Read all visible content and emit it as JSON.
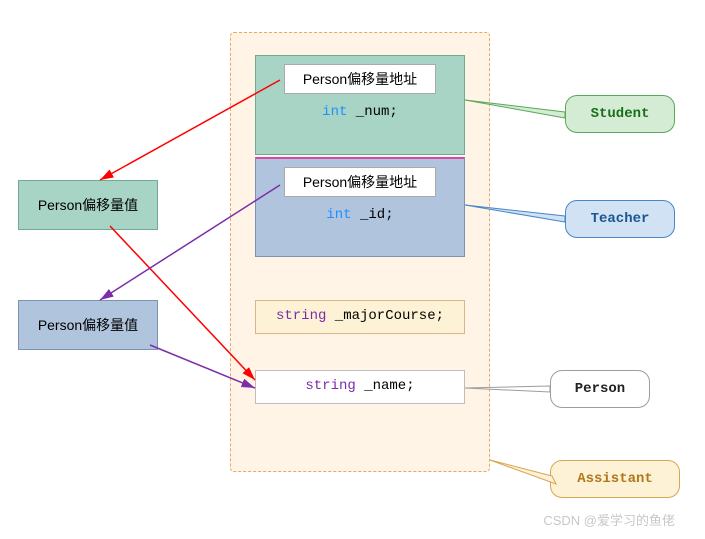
{
  "left": {
    "offset_value_1": "Person偏移量值",
    "offset_value_2": "Person偏移量值"
  },
  "container": {
    "student": {
      "addr_label": "Person偏移量地址",
      "member_type": "int",
      "member_name": "_num;"
    },
    "teacher": {
      "addr_label": "Person偏移量地址",
      "member_type": "int",
      "member_name": "_id;"
    },
    "major": {
      "type": "string",
      "name": "_majorCourse;"
    },
    "name_field": {
      "type": "string",
      "name": "_name;"
    }
  },
  "callouts": {
    "student": "Student",
    "teacher": "Teacher",
    "person": "Person",
    "assistant": "Assistant"
  },
  "watermark": "CSDN @爱学习的鱼佬"
}
